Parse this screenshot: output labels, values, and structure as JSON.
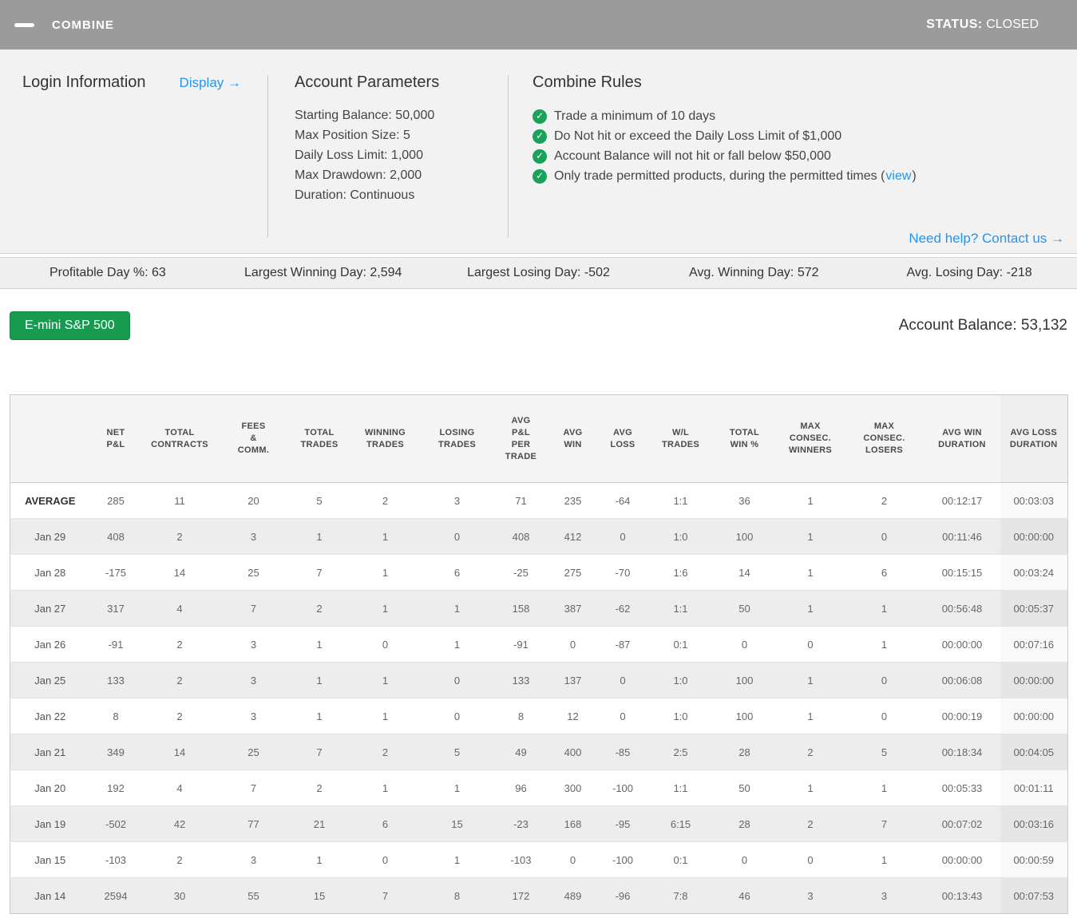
{
  "header": {
    "title": "COMBINE",
    "status_label": "STATUS:",
    "status_value": "CLOSED"
  },
  "login": {
    "heading": "Login Information",
    "display_link": "Display →"
  },
  "account_parameters": {
    "heading": "Account Parameters",
    "items": [
      "Starting Balance: 50,000",
      "Max Position Size: 5",
      "Daily Loss Limit: 1,000",
      "Max Drawdown: 2,000",
      "Duration: Continuous"
    ]
  },
  "combine_rules": {
    "heading": "Combine Rules",
    "rules": [
      {
        "prefix": "Trade a minimum of 10 days"
      },
      {
        "prefix": "Do Not hit or exceed the Daily Loss Limit of $1,000"
      },
      {
        "prefix": "Account Balance will not hit or fall below $50,000"
      },
      {
        "prefix": "Only trade permitted products, during the permitted times (",
        "link": "view",
        "suffix": ")"
      }
    ],
    "help_link": "Need help? Contact us →"
  },
  "stats": [
    "Profitable Day %: 63",
    "Largest Winning Day: 2,594",
    "Largest Losing Day: -502",
    "Avg. Winning Day: 572",
    "Avg. Losing Day: -218"
  ],
  "instrument_button": "E-mini S&P 500",
  "account_balance": "Account Balance: 53,132",
  "table": {
    "columns": [
      [
        ""
      ],
      [
        "NET",
        "P&L"
      ],
      [
        "TOTAL",
        "CONTRACTS"
      ],
      [
        "FEES",
        "&",
        "COMM."
      ],
      [
        "TOTAL",
        "TRADES"
      ],
      [
        "WINNING",
        "TRADES"
      ],
      [
        "LOSING",
        "TRADES"
      ],
      [
        "AVG",
        "P&L",
        "PER",
        "TRADE"
      ],
      [
        "AVG",
        "WIN"
      ],
      [
        "AVG",
        "LOSS"
      ],
      [
        "W/L",
        "TRADES"
      ],
      [
        "TOTAL",
        "WIN %"
      ],
      [
        "MAX",
        "CONSEC.",
        "WINNERS"
      ],
      [
        "MAX",
        "CONSEC.",
        "LOSERS"
      ],
      [
        "AVG WIN",
        "DURATION"
      ],
      [
        "AVG LOSS",
        "DURATION"
      ]
    ],
    "rows": [
      {
        "label": "AVERAGE",
        "bold": true,
        "cells": [
          "285",
          "11",
          "20",
          "5",
          "2",
          "3",
          "71",
          "235",
          "-64",
          "1:1",
          "36",
          "1",
          "2",
          "00:12:17",
          "00:03:03"
        ]
      },
      {
        "label": "Jan 29",
        "bold": false,
        "cells": [
          "408",
          "2",
          "3",
          "1",
          "1",
          "0",
          "408",
          "412",
          "0",
          "1:0",
          "100",
          "1",
          "0",
          "00:11:46",
          "00:00:00"
        ]
      },
      {
        "label": "Jan 28",
        "bold": false,
        "cells": [
          "-175",
          "14",
          "25",
          "7",
          "1",
          "6",
          "-25",
          "275",
          "-70",
          "1:6",
          "14",
          "1",
          "6",
          "00:15:15",
          "00:03:24"
        ]
      },
      {
        "label": "Jan 27",
        "bold": false,
        "cells": [
          "317",
          "4",
          "7",
          "2",
          "1",
          "1",
          "158",
          "387",
          "-62",
          "1:1",
          "50",
          "1",
          "1",
          "00:56:48",
          "00:05:37"
        ]
      },
      {
        "label": "Jan 26",
        "bold": false,
        "cells": [
          "-91",
          "2",
          "3",
          "1",
          "0",
          "1",
          "-91",
          "0",
          "-87",
          "0:1",
          "0",
          "0",
          "1",
          "00:00:00",
          "00:07:16"
        ]
      },
      {
        "label": "Jan 25",
        "bold": false,
        "cells": [
          "133",
          "2",
          "3",
          "1",
          "1",
          "0",
          "133",
          "137",
          "0",
          "1:0",
          "100",
          "1",
          "0",
          "00:06:08",
          "00:00:00"
        ]
      },
      {
        "label": "Jan 22",
        "bold": false,
        "cells": [
          "8",
          "2",
          "3",
          "1",
          "1",
          "0",
          "8",
          "12",
          "0",
          "1:0",
          "100",
          "1",
          "0",
          "00:00:19",
          "00:00:00"
        ]
      },
      {
        "label": "Jan 21",
        "bold": false,
        "cells": [
          "349",
          "14",
          "25",
          "7",
          "2",
          "5",
          "49",
          "400",
          "-85",
          "2:5",
          "28",
          "2",
          "5",
          "00:18:34",
          "00:04:05"
        ]
      },
      {
        "label": "Jan 20",
        "bold": false,
        "cells": [
          "192",
          "4",
          "7",
          "2",
          "1",
          "1",
          "96",
          "300",
          "-100",
          "1:1",
          "50",
          "1",
          "1",
          "00:05:33",
          "00:01:11"
        ]
      },
      {
        "label": "Jan 19",
        "bold": false,
        "cells": [
          "-502",
          "42",
          "77",
          "21",
          "6",
          "15",
          "-23",
          "168",
          "-95",
          "6:15",
          "28",
          "2",
          "7",
          "00:07:02",
          "00:03:16"
        ]
      },
      {
        "label": "Jan 15",
        "bold": false,
        "cells": [
          "-103",
          "2",
          "3",
          "1",
          "0",
          "1",
          "-103",
          "0",
          "-100",
          "0:1",
          "0",
          "0",
          "1",
          "00:00:00",
          "00:00:59"
        ]
      },
      {
        "label": "Jan 14",
        "bold": false,
        "cells": [
          "2594",
          "30",
          "55",
          "15",
          "7",
          "8",
          "172",
          "489",
          "-96",
          "7:8",
          "46",
          "3",
          "3",
          "00:13:43",
          "00:07:53"
        ]
      }
    ]
  },
  "colors": {
    "titlebar_gray": "#9b9b9b",
    "accent_blue": "#2196f3",
    "button_green": "#189b50",
    "check_green": "#1aa15b"
  }
}
